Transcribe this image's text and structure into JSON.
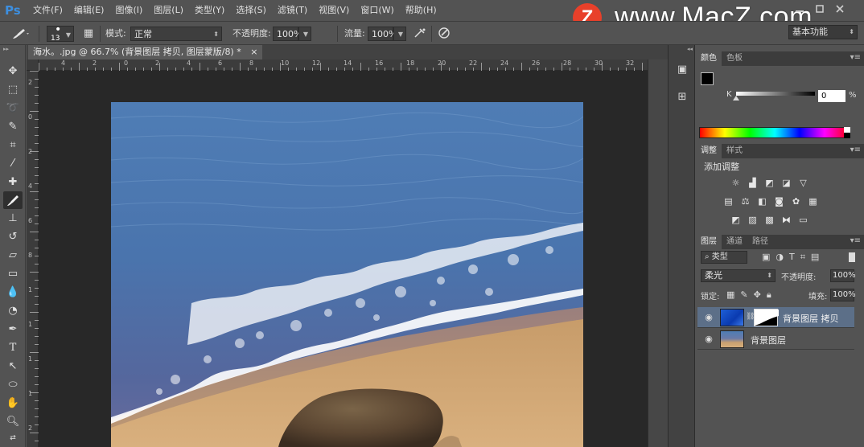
{
  "app": {
    "logo": "Ps"
  },
  "menu": {
    "items": [
      "文件(F)",
      "编辑(E)",
      "图像(I)",
      "图层(L)",
      "类型(Y)",
      "选择(S)",
      "滤镜(T)",
      "视图(V)",
      "窗口(W)",
      "帮助(H)"
    ]
  },
  "watermark": {
    "logo_letter": "Z",
    "text": "www.MacZ.com"
  },
  "workspace": {
    "label": "基本功能"
  },
  "options": {
    "brush_size": "13",
    "mode_label": "模式:",
    "mode_value": "正常",
    "opacity_label": "不透明度:",
    "opacity_value": "100%",
    "flow_label": "流量:",
    "flow_value": "100%"
  },
  "document": {
    "tab_title": "海水。.jpg @ 66.7% (背景图层 拷贝, 图层蒙版/8) *",
    "close_glyph": "×"
  },
  "rulers": {
    "h_ticks": [
      "4",
      "2",
      "0",
      "2",
      "4",
      "6",
      "8",
      "10",
      "12",
      "14",
      "16",
      "18",
      "20",
      "22",
      "24",
      "26",
      "28",
      "30",
      "32"
    ],
    "v_ticks": [
      "2",
      "0",
      "2",
      "4",
      "6",
      "8",
      "1",
      "1",
      "1",
      "1",
      "2"
    ]
  },
  "color_panel": {
    "tabs": [
      "颜色",
      "色板"
    ],
    "channel_label": "K",
    "channel_value": "0",
    "percent": "%"
  },
  "adjustments_panel": {
    "tabs": [
      "调整",
      "样式"
    ],
    "title": "添加调整",
    "icons_row1": [
      "brightness-icon",
      "levels-icon",
      "curves-icon",
      "exposure-icon",
      "vibrance-icon"
    ],
    "icons_row2": [
      "hue-sat-icon",
      "color-balance-icon",
      "black-white-icon",
      "photo-filter-icon",
      "channel-mixer-icon",
      "color-lookup-icon"
    ],
    "icons_row3": [
      "invert-icon",
      "posterize-icon",
      "threshold-icon",
      "selective-color-icon",
      "gradient-map-icon"
    ]
  },
  "layers_panel": {
    "tabs": [
      "图层",
      "通道",
      "路径"
    ],
    "filter_kind": "类型",
    "blend_mode": "柔光",
    "opacity_label": "不透明度:",
    "opacity_value": "100%",
    "lock_label": "锁定:",
    "fill_label": "填充:",
    "fill_value": "100%",
    "layers": [
      {
        "name": "背景图层 拷贝",
        "selected": true
      },
      {
        "name": "背景图层",
        "selected": false
      }
    ]
  },
  "colors": {
    "ui_bg": "#535353",
    "canvas_bg": "#282828",
    "selection": "#5c6f88",
    "watermark_red": "#e8402a"
  }
}
